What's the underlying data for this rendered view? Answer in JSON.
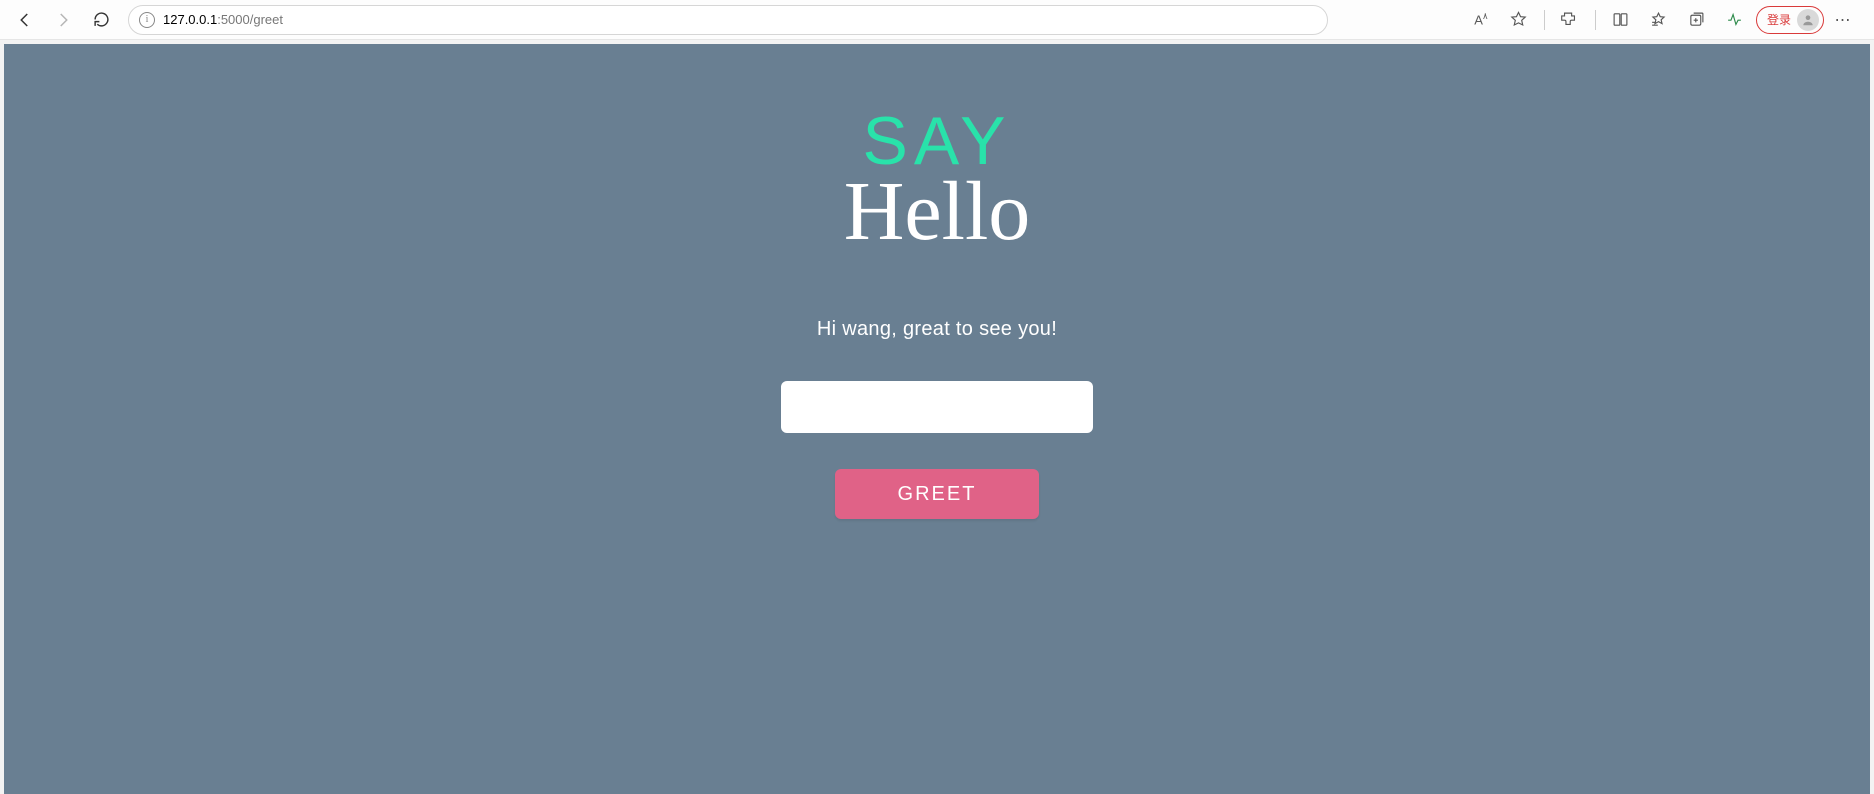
{
  "browser": {
    "url_host": "127.0.0.1",
    "url_port_path": ":5000/greet",
    "login_label": "登录"
  },
  "page": {
    "title_top": "SAY",
    "title_bottom": "Hello",
    "greeting_text": "Hi wang, great to see you!",
    "input_value": "",
    "button_label": "GREET"
  },
  "colors": {
    "page_bg": "#697f92",
    "accent_green": "#29e2aa",
    "button_pink": "#e06287"
  }
}
